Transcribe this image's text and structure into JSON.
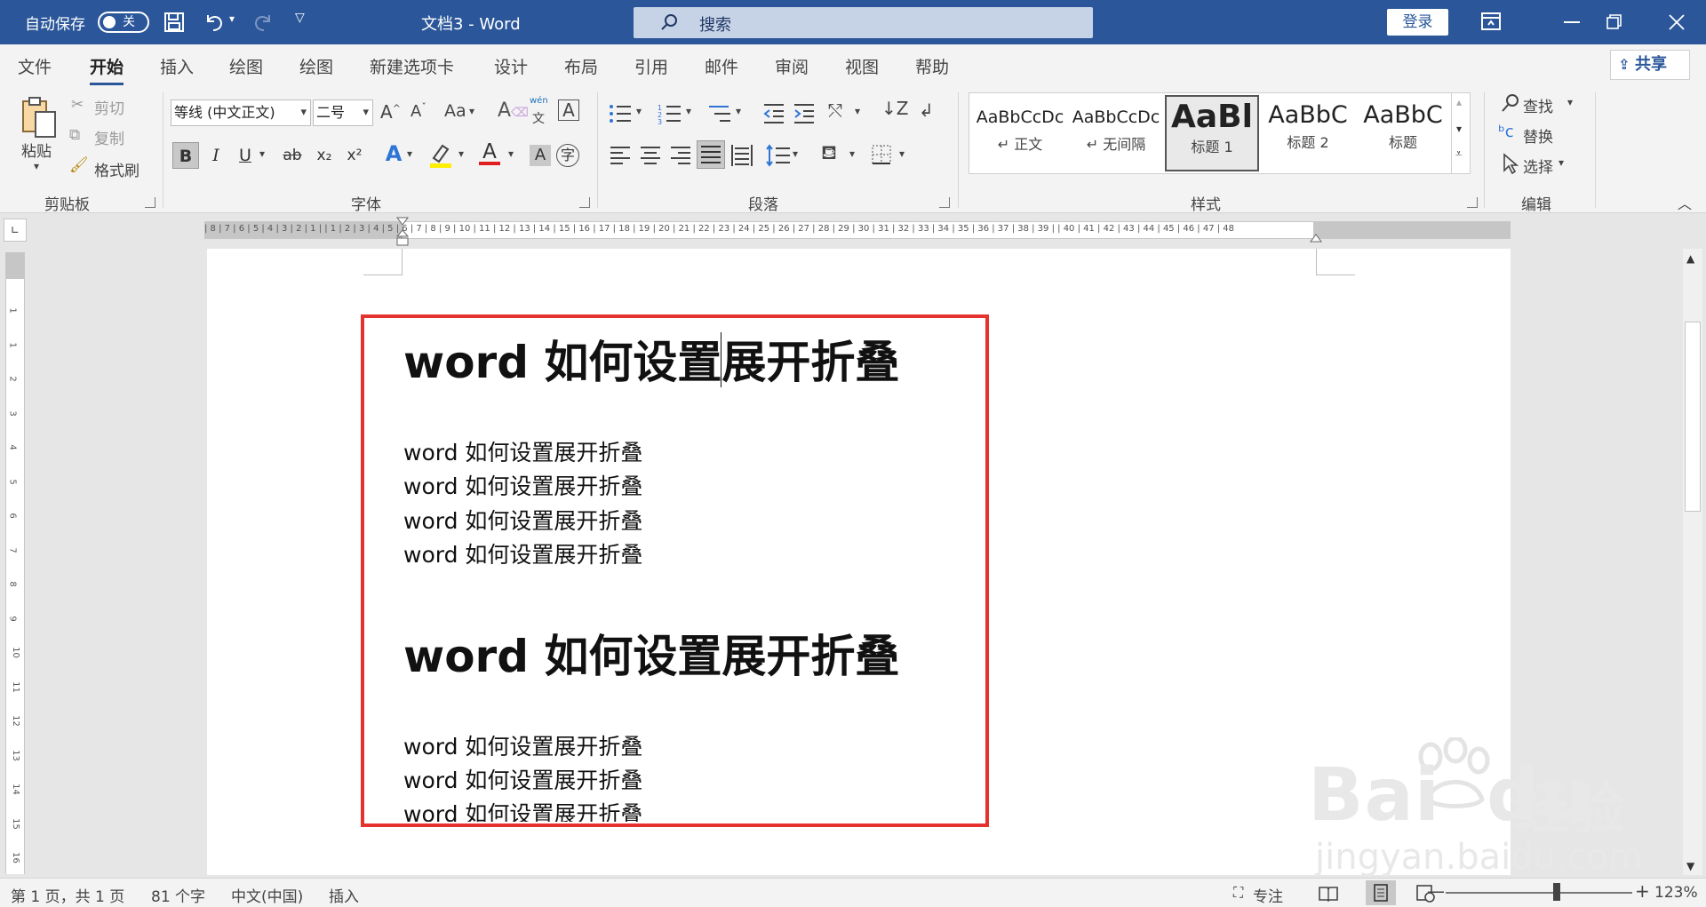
{
  "titlebar": {
    "autosave_label": "自动保存",
    "autosave_state": "关",
    "doc_title": "文档3  -  Word",
    "search_placeholder": "搜索",
    "login": "登录"
  },
  "tabs": [
    "文件",
    "开始",
    "插入",
    "绘图",
    "绘图",
    "新建选项卡",
    "设计",
    "布局",
    "引用",
    "邮件",
    "审阅",
    "视图",
    "帮助"
  ],
  "active_tab": "开始",
  "share": "共享",
  "clipboard": {
    "paste": "粘贴",
    "cut": "剪切",
    "copy": "复制",
    "format_painter": "格式刷",
    "group": "剪贴板"
  },
  "font": {
    "font_name": "等线 (中文正文)",
    "font_size": "二号",
    "group": "字体",
    "phonetic_top": "wén",
    "phonetic_bottom": "文",
    "grow": "A^",
    "shrink": "Aˇ",
    "change_case": "Aa",
    "bold": "B",
    "italic": "I",
    "underline": "U",
    "strike": "ab",
    "subscript": "x₂",
    "superscript": "x²",
    "text_effect": "A",
    "font_color": "A",
    "shading": "A",
    "enclosed": "字"
  },
  "paragraph": {
    "group": "段落"
  },
  "styles": {
    "group": "样式",
    "items": [
      {
        "sample": "AaBbCcDc",
        "name": "↵ 正文"
      },
      {
        "sample": "AaBbCcDc",
        "name": "↵ 无间隔"
      },
      {
        "sample": "AaBl",
        "name": "标题 1"
      },
      {
        "sample": "AaBbC",
        "name": "标题 2"
      },
      {
        "sample": "AaBbC",
        "name": "标题"
      }
    ]
  },
  "editing": {
    "find": "查找",
    "replace": "替换",
    "select": "选择",
    "group": "编辑"
  },
  "ruler": {
    "numbers": "| 8 | 7 | 6 | 5 | 4 | 3 | 2 | 1 |   | 1 | 2 | 3 | 4 | 5 | 6 | 7 | 8 | 9 | 10 | 11 | 12 | 13 | 14 | 15 | 16 | 17 | 18 | 19 | 20 | 21 | 22 | 23 | 24 | 25 | 26 | 27 | 28 | 29 | 30 | 31 | 32 | 33 | 34 | 35 | 36 | 37 | 38 | 39 |   | 40 | 41 | 42 | 43 | 44 | 45 | 46 | 47 | 48",
    "vnumbers": [
      "1",
      "1",
      "2",
      "3",
      "4",
      "5",
      "6",
      "7",
      "8",
      "9",
      "10",
      "11",
      "12",
      "13",
      "14",
      "15",
      "16",
      "17"
    ]
  },
  "document": {
    "heading1": "word 如何设置展开折叠",
    "paras1": [
      "word 如何设置展开折叠",
      "word 如何设置展开折叠",
      "word 如何设置展开折叠",
      "word 如何设置展开折叠"
    ],
    "heading2": "word 如何设置展开折叠",
    "paras2": [
      "word 如何设置展开折叠",
      "word 如何设置展开折叠",
      "word 如何设置展开折叠"
    ]
  },
  "statusbar": {
    "page": "第 1 页，共 1 页",
    "words": "81 个字",
    "language": "中文(中国)",
    "mode": "插入",
    "focus": "专注",
    "zoom": "123%",
    "minus": "—",
    "plus": "+"
  },
  "watermark": {
    "brand": "Bai",
    "brand2": "du",
    "cn": "经验",
    "url": "jingyan.baidu.com"
  },
  "colors": {
    "titlebar": "#2b579a",
    "highlight": "#e5322f"
  }
}
